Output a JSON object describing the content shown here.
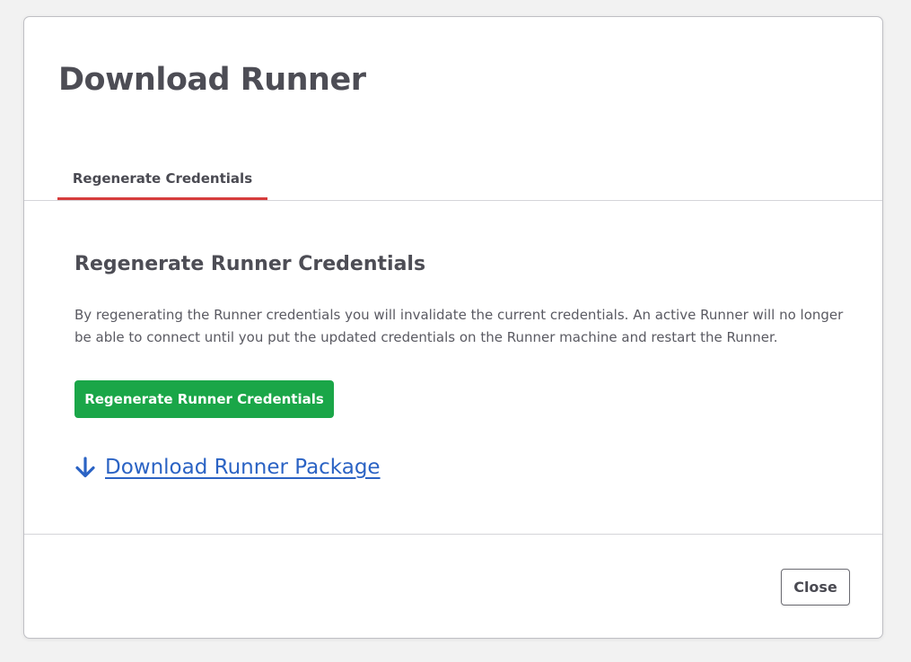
{
  "modal": {
    "title": "Download Runner",
    "tabs": [
      {
        "label": "Regenerate Credentials",
        "active": true
      }
    ],
    "section": {
      "title": "Regenerate Runner Credentials",
      "description": "By regenerating the Runner credentials you will invalidate the current credentials. An active Runner will no longer be able to connect until you put the updated credentials on the Runner machine and restart the Runner.",
      "regenerate_button_label": "Regenerate Runner Credentials"
    },
    "download": {
      "icon": "arrow-down-icon",
      "label": "Download Runner Package"
    },
    "footer": {
      "close_label": "Close"
    }
  },
  "colors": {
    "tab_underline": "#d63c3c",
    "primary_button": "#1aa648",
    "link": "#2b63c4"
  }
}
